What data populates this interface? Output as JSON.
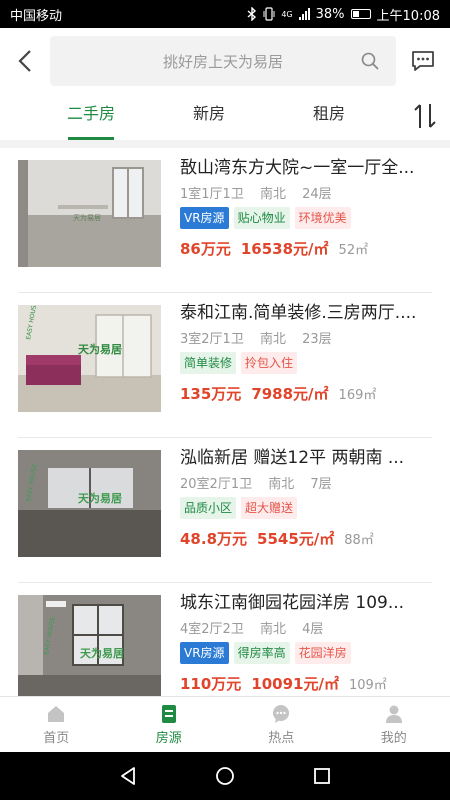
{
  "status_bar": {
    "carrier": "中国移动",
    "network": "4G",
    "battery": "38%",
    "time": "上午10:08"
  },
  "header": {
    "search_placeholder": "挑好房上天为易居"
  },
  "tabs": [
    {
      "label": "二手房",
      "active": true
    },
    {
      "label": "新房",
      "active": false
    },
    {
      "label": "租房",
      "active": false
    }
  ],
  "listings": [
    {
      "title": "敔山湾东方大院~一室一厅全...",
      "layout": "1室1厅1卫",
      "orientation": "南北",
      "floor": "24层",
      "tags": [
        {
          "text": "VR房源",
          "style": "vr"
        },
        {
          "text": "贴心物业",
          "style": "green"
        },
        {
          "text": "环境优美",
          "style": "pink"
        }
      ],
      "price": "86万元",
      "unit_price": "16538元/㎡",
      "area": "52㎡"
    },
    {
      "title": "泰和江南.简单装修.三房两厅....",
      "layout": "3室2厅1卫",
      "orientation": "南北",
      "floor": "23层",
      "tags": [
        {
          "text": "简单装修",
          "style": "green"
        },
        {
          "text": "拎包入住",
          "style": "pink"
        }
      ],
      "price": "135万元",
      "unit_price": "7988元/㎡",
      "area": "169㎡"
    },
    {
      "title": "泓临新居 赠送12平 两朝南 ...",
      "layout": "20室2厅1卫",
      "orientation": "南北",
      "floor": "7层",
      "tags": [
        {
          "text": "品质小区",
          "style": "green"
        },
        {
          "text": "超大赠送",
          "style": "pink"
        }
      ],
      "price": "48.8万元",
      "unit_price": "5545元/㎡",
      "area": "88㎡"
    },
    {
      "title": "城东江南御园花园洋房 109...",
      "layout": "4室2厅2卫",
      "orientation": "南北",
      "floor": "4层",
      "tags": [
        {
          "text": "VR房源",
          "style": "vr"
        },
        {
          "text": "得房率高",
          "style": "green"
        },
        {
          "text": "花园洋房",
          "style": "pink"
        }
      ],
      "price": "110万元",
      "unit_price": "10091元/㎡",
      "area": "109㎡"
    }
  ],
  "bottom_nav": [
    {
      "label": "首页",
      "icon": "home-icon",
      "active": false
    },
    {
      "label": "房源",
      "icon": "listings-icon",
      "active": true
    },
    {
      "label": "热点",
      "icon": "chat-bubble-icon",
      "active": false
    },
    {
      "label": "我的",
      "icon": "profile-icon",
      "active": false
    }
  ],
  "colors": {
    "accent": "#1e8a42",
    "price": "#e0452b",
    "vr_tag": "#2b7bd6"
  }
}
